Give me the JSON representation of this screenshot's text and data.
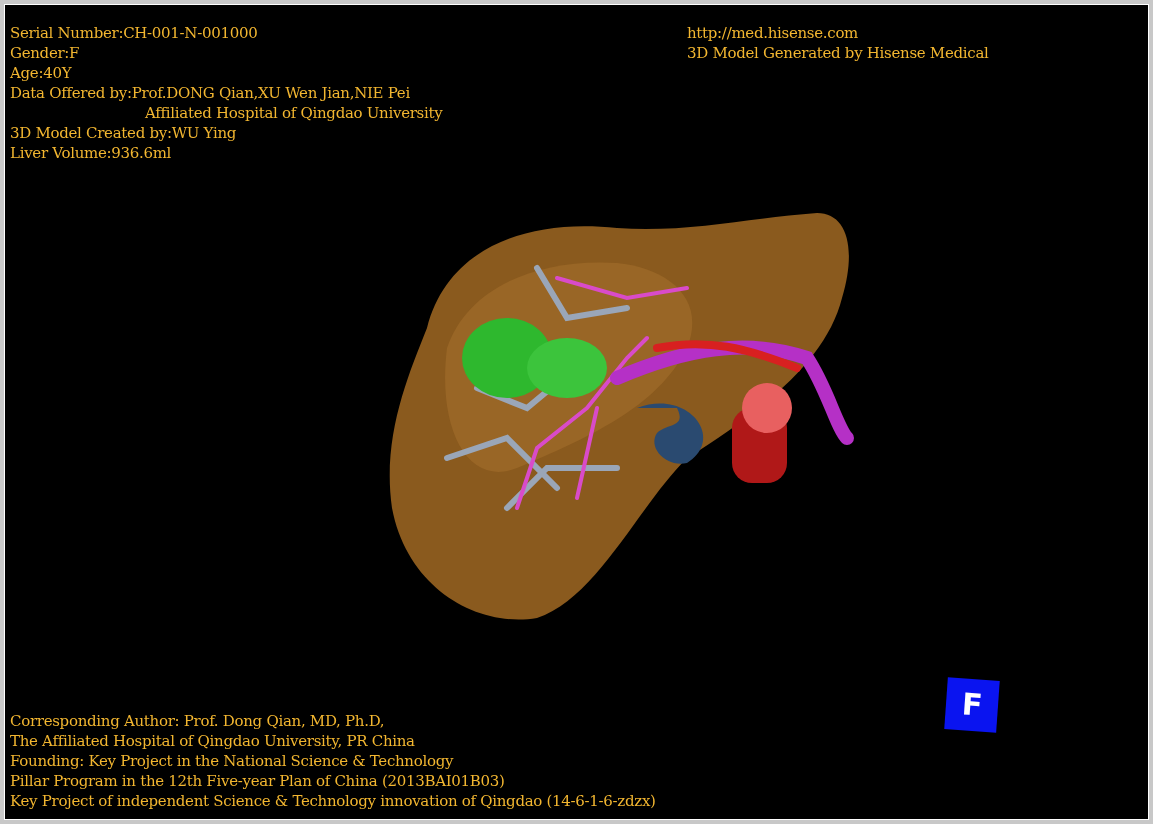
{
  "top_left_info": [
    {
      "kind": "line",
      "text": "Serial Number:CH-001-N-001000"
    },
    {
      "kind": "line",
      "text": "Gender:F"
    },
    {
      "kind": "line",
      "text": "Age:40Y"
    },
    {
      "kind": "line",
      "text": "Data Offered by:Prof.DONG Qian,XU Wen Jian,NIE Pei"
    },
    {
      "kind": "indented",
      "text": "Affiliated Hospital of Qingdao University"
    },
    {
      "kind": "line",
      "text": "3D Model Created by:WU Ying"
    },
    {
      "kind": "line",
      "text": "Liver Volume:936.6ml"
    }
  ],
  "top_right_info": {
    "link": "http://med.hisense.com",
    "caption": "3D Model Generated by Hisense Medical"
  },
  "viewport": {
    "kind": "organ"
  },
  "bottom_info": [
    "Corresponding Author: Prof. Dong Qian, MD, Ph.D,",
    "The Affiliated Hospital of Qingdao University, PR China",
    "Founding: Key Project in the National Science & Technology",
    "Pillar Program in the 12th Five-year Plan of China (2013BAI01B03)",
    "Key Project of independent Science & Technology innovation of Qingdao (14-6-1-6-zdzx)"
  ],
  "orientation_marker": "F"
}
